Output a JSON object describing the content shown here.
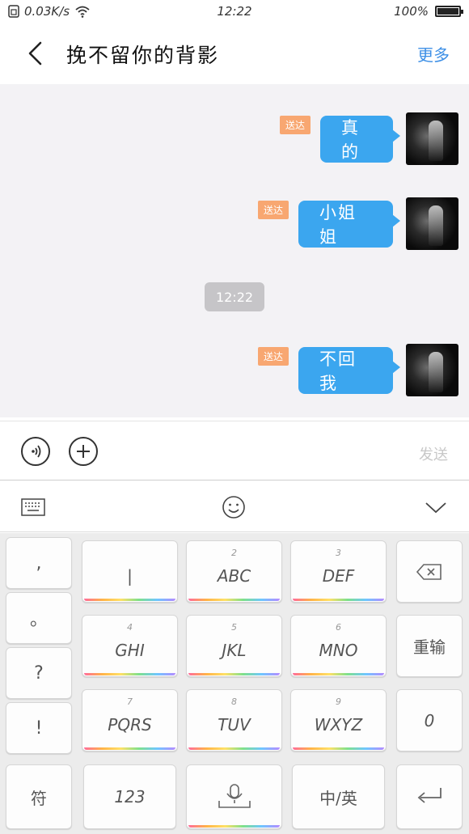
{
  "status_bar": {
    "net_speed": "0.03K/s",
    "time": "12:22",
    "battery": "100%",
    "battery_level": 1.0
  },
  "header": {
    "title": "挽不留你的背影",
    "more_label": "更多"
  },
  "messages": [
    {
      "text": "真的",
      "status": "送达"
    },
    {
      "text": "小姐姐",
      "status": "送达"
    },
    {
      "text": "不回我",
      "status": "送达"
    }
  ],
  "chat_timestamp": "12:22",
  "input": {
    "send_label": "发送"
  },
  "keyboard": {
    "punct": [
      ",",
      "。",
      "?",
      "!"
    ],
    "symbol_key": "符",
    "number_key": "123",
    "lang_key": "中/英",
    "reinput_key": "重输",
    "letters": [
      {
        "num": "",
        "label": "|"
      },
      {
        "num": "2",
        "label": "ABC"
      },
      {
        "num": "3",
        "label": "DEF"
      },
      {
        "num": "4",
        "label": "GHI"
      },
      {
        "num": "5",
        "label": "JKL"
      },
      {
        "num": "6",
        "label": "MNO"
      },
      {
        "num": "7",
        "label": "PQRS"
      },
      {
        "num": "8",
        "label": "TUV"
      },
      {
        "num": "9",
        "label": "WXYZ"
      }
    ],
    "zero_key": "0"
  },
  "colors": {
    "bubble": "#3ba6ef",
    "status_badge": "#f8a771",
    "accent": "#3d8fe6"
  }
}
